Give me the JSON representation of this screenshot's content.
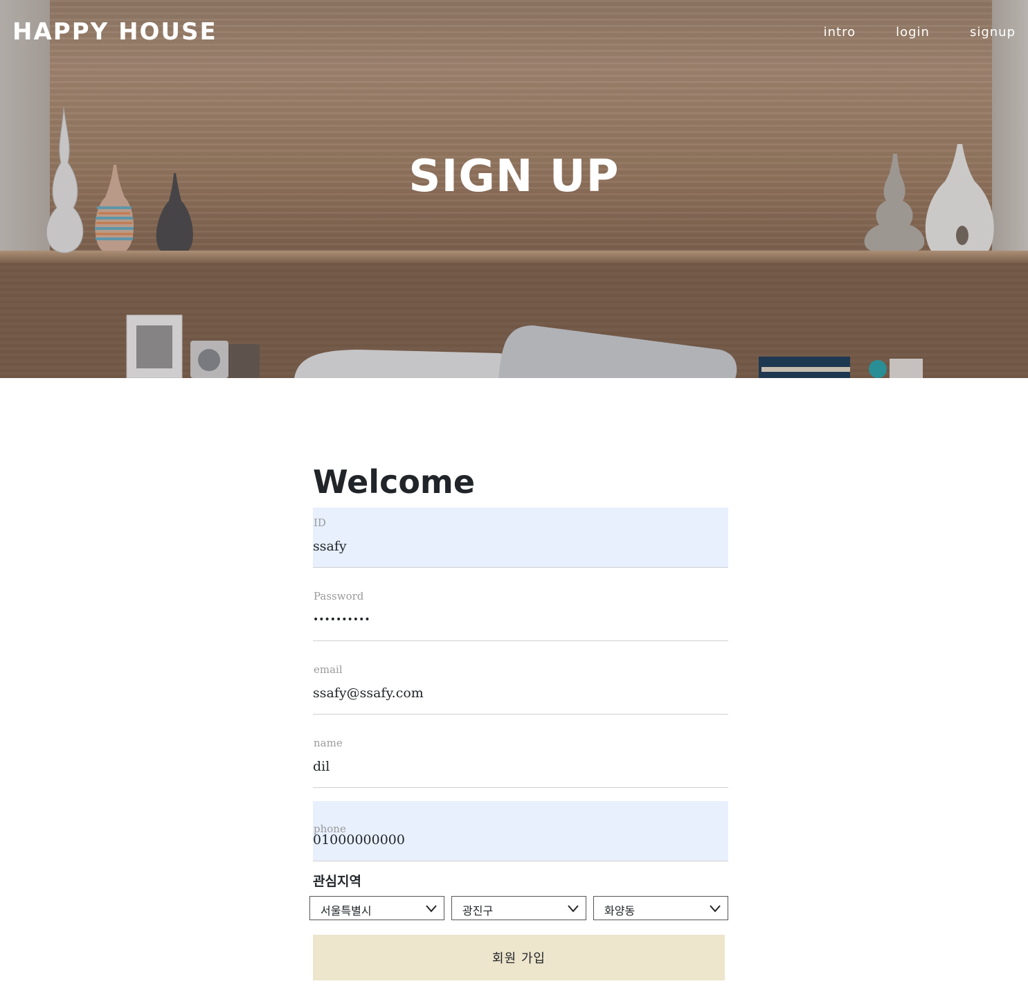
{
  "header": {
    "brand": "HAPPY HOUSE",
    "nav": {
      "intro": "intro",
      "login": "login",
      "signup": "signup"
    },
    "hero_title": "SIGN UP"
  },
  "form": {
    "title": "Welcome",
    "fields": {
      "id": {
        "label": "ID",
        "value": "ssafy"
      },
      "password": {
        "label": "Password",
        "masked": "••••••••••"
      },
      "email": {
        "label": "email",
        "value": "ssafy@ssafy.com"
      },
      "name": {
        "label": "name",
        "value": "dil"
      },
      "phone": {
        "label": "phone",
        "value": "01000000000"
      }
    },
    "region": {
      "title": "관심지역",
      "city": "서울특별시",
      "district": "광진구",
      "dong": "화양동"
    },
    "submit_label": "회원 가입"
  },
  "colors": {
    "autofill_bg": "#e8f0fe",
    "submit_bg": "#ede5cc",
    "text": "#212529"
  }
}
